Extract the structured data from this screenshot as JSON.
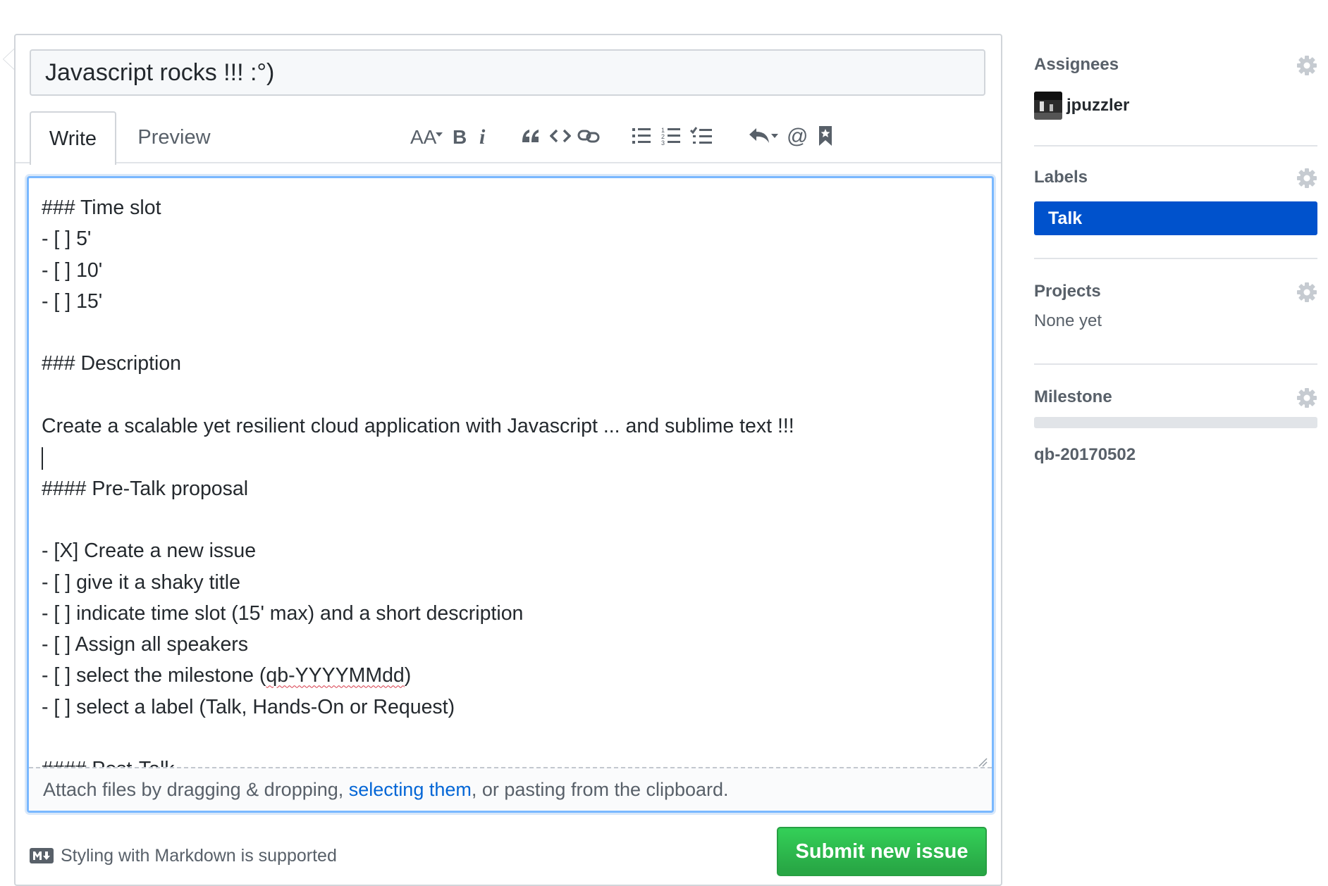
{
  "issue": {
    "title": "Javascript rocks !!! :°)"
  },
  "tabs": {
    "write": "Write",
    "preview": "Preview"
  },
  "toolbar": {
    "buttons": [
      {
        "name": "text-size-icon"
      },
      {
        "name": "bold-icon"
      },
      {
        "name": "italic-icon"
      },
      {
        "name": "quote-icon"
      },
      {
        "name": "code-icon"
      },
      {
        "name": "link-icon"
      },
      {
        "name": "bulleted-list-icon"
      },
      {
        "name": "numbered-list-icon"
      },
      {
        "name": "task-list-icon"
      },
      {
        "name": "reply-icon"
      },
      {
        "name": "mention-icon"
      },
      {
        "name": "bookmark-icon"
      }
    ]
  },
  "editor": {
    "lines": [
      "### Time slot",
      "- [ ] 5'",
      "- [ ] 10'",
      "- [ ] 15'",
      "",
      "### Description",
      "",
      "Create a scalable yet resilient cloud application with Javascript ... and sublime text !!!",
      "",
      "#### Pre-Talk proposal",
      "",
      "- [X] Create a new issue",
      "- [ ] give it a shaky title",
      "- [ ] indicate time slot (15' max) and a short description",
      "- [ ] Assign all speakers",
      "- [ ] select the milestone (",
      "- [ ] select a label (Talk, Hands-On or Request)",
      "",
      "#### Post-Talk"
    ],
    "misspelled": "qb-YYYYMMdd",
    "after_misspelled": ")",
    "drop_hint_before": "Attach files by dragging & dropping, ",
    "drop_hint_link": "selecting them",
    "drop_hint_after": ", or pasting from the clipboard."
  },
  "footer": {
    "markdown_note": "Styling with Markdown is supported",
    "submit_label": "Submit new issue"
  },
  "sidebar": {
    "assignees": {
      "heading": "Assignees",
      "user": "jpuzzler"
    },
    "labels": {
      "heading": "Labels",
      "label": "Talk",
      "label_color": "#0052cc"
    },
    "projects": {
      "heading": "Projects",
      "value": "None yet"
    },
    "milestone": {
      "heading": "Milestone",
      "value": "qb-20170502"
    }
  },
  "colors": {
    "submit": "#2cbe4e",
    "link": "#0366d6",
    "focus_border": "#79b8ff"
  }
}
